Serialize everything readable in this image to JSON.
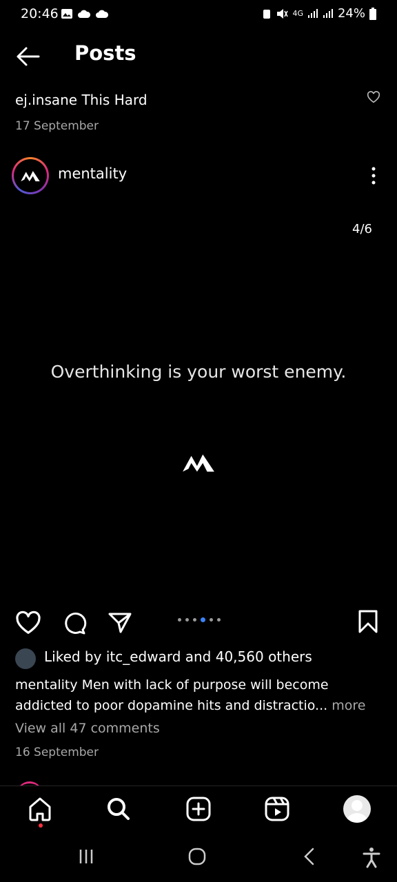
{
  "status": {
    "time": "20:46",
    "network": "4G",
    "battery": "24%"
  },
  "header": {
    "title": "Posts"
  },
  "previous_post": {
    "caption": "ej.insane This Hard",
    "date": "17 September"
  },
  "post": {
    "username": "mentality",
    "page_indicator": "4/6",
    "quote": "Overthinking is your worst enemy.",
    "carousel": {
      "count": 6,
      "current": 4
    },
    "likes_text": "Liked by itc_edward and 40,560 others",
    "caption_user": "mentality",
    "caption_text": " Men with lack of purpose will become addicted to poor dopamine hits and distractio...",
    "more_label": " more",
    "view_comments": "View all 47 comments",
    "date": "16 September"
  },
  "colors": {
    "background": "#000000",
    "active_dot": "#3b82f6",
    "notification_dot": "#ff3040"
  }
}
